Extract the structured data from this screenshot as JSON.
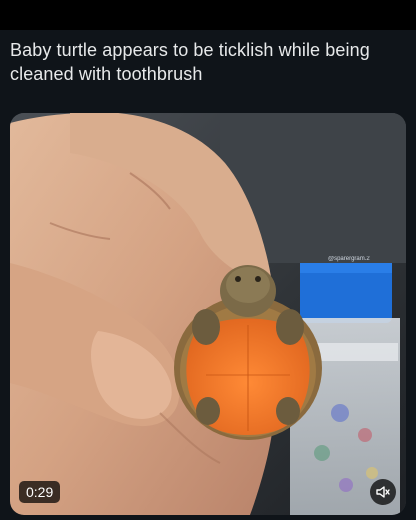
{
  "post": {
    "text": "Baby turtle appears to be ticklish while being cleaned with toothbrush"
  },
  "video": {
    "watermark": "@sparergram.2",
    "time": "0:29",
    "volume_icon": "speaker-muted-icon"
  },
  "colors": {
    "background": "#0f1419",
    "text": "#e7e9ea",
    "turtle_plastron": "#f07a2a"
  }
}
